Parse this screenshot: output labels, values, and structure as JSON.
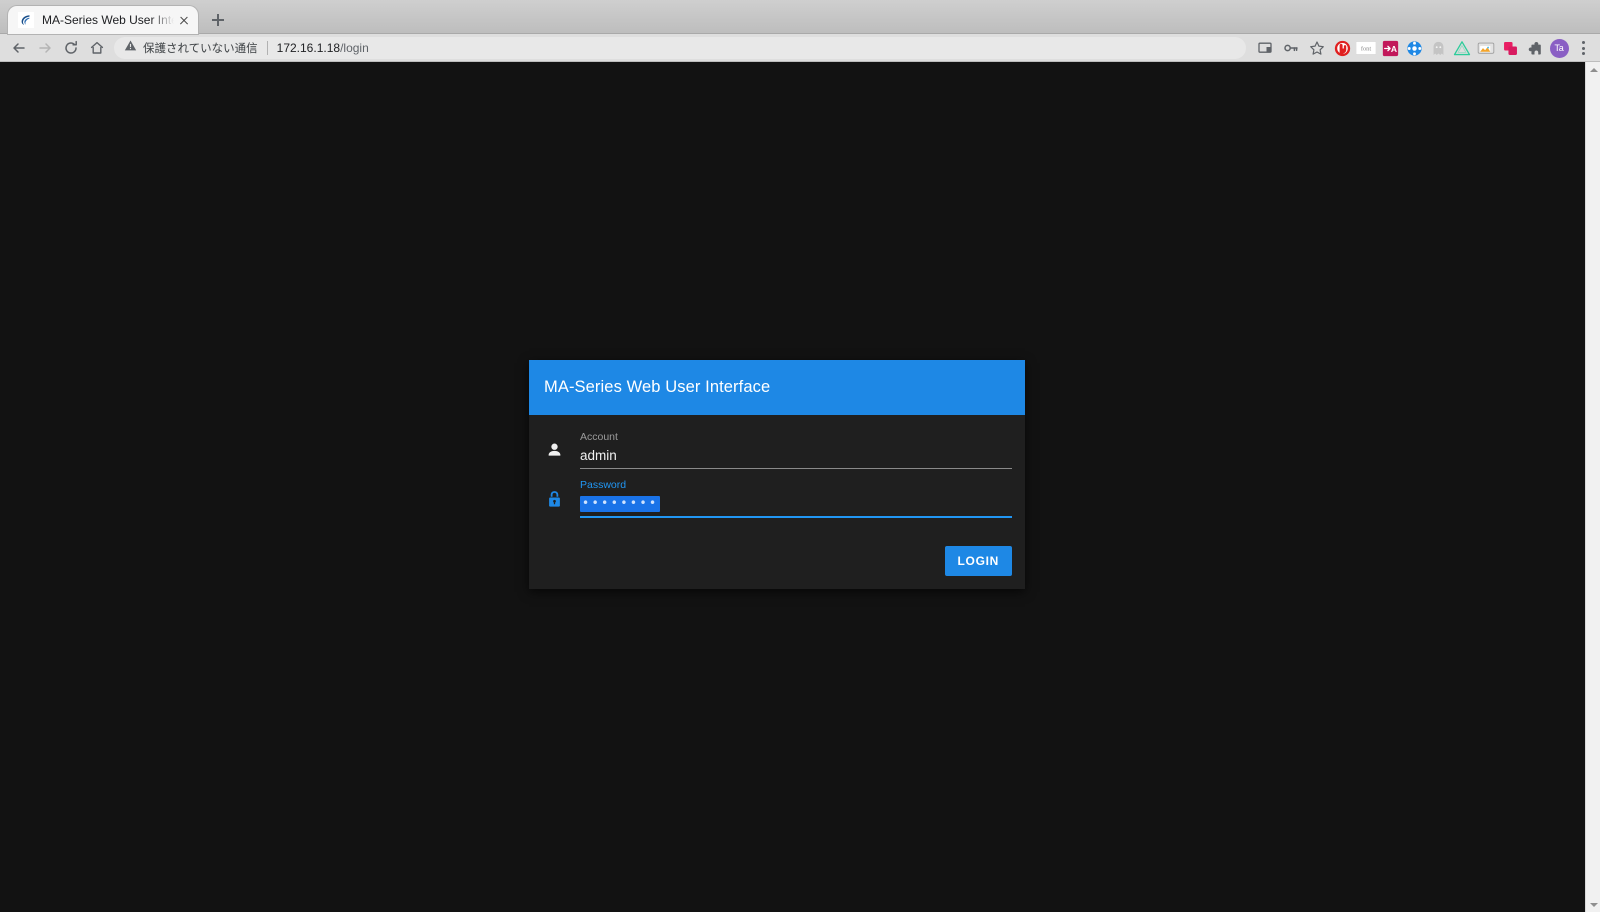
{
  "browser": {
    "tab": {
      "title": "MA-Series Web User Inter",
      "favicon": "crescent-favicon",
      "close_label": "×"
    },
    "new_tab_label": "+",
    "nav": {
      "back": "back-arrow",
      "forward": "forward-arrow",
      "reload": "reload",
      "home": "home"
    },
    "omnibox": {
      "security_text": "保護されていない通信",
      "security_icon": "warning-triangle",
      "url_host": "172.16.1.18",
      "url_path": "/login",
      "separator": "|"
    },
    "toolbar_icons": [
      {
        "name": "cast-icon",
        "glyph": "cast"
      },
      {
        "name": "password-key-icon",
        "glyph": "key"
      },
      {
        "name": "bookmark-star-icon",
        "glyph": "star"
      }
    ],
    "extensions": [
      {
        "name": "ublock-origin-icon",
        "label": "",
        "color": "#e02020"
      },
      {
        "name": "font-extension-icon",
        "label": "font",
        "color": "#ffffff"
      },
      {
        "name": "translate-extension-icon",
        "label": "A",
        "color": "#c2185b"
      },
      {
        "name": "bluetooth-extension-icon",
        "label": "",
        "color": "#1e88e5"
      },
      {
        "name": "ghost-extension-icon",
        "label": "",
        "color": "#bdbdbd"
      },
      {
        "name": "triangle-extension-icon",
        "label": "",
        "color": "#2ecc9b"
      },
      {
        "name": "screenshot-extension-icon",
        "label": "",
        "color": "#9e9e9e"
      },
      {
        "name": "copy-extension-icon",
        "label": "",
        "color": "#e91e63"
      },
      {
        "name": "puzzle-extensions-icon",
        "label": "",
        "color": "#5f6368"
      }
    ],
    "profile": {
      "initials": "Ta",
      "color": "#8a5fc4"
    },
    "menu": "chrome-menu"
  },
  "scrollbar": {
    "up_arrow": "scroll-up",
    "down_arrow": "scroll-down"
  },
  "login": {
    "header_title": "MA-Series Web User Interface",
    "account": {
      "label": "Account",
      "value": "admin",
      "placeholder": "",
      "icon": "person-icon"
    },
    "password": {
      "label": "Password",
      "value": "••••••••",
      "masked_char_count": 8,
      "placeholder": "",
      "icon": "lock-icon",
      "focused": true,
      "selected": true
    },
    "submit_label": "LOGIN",
    "colors": {
      "accent": "#1e88e5",
      "card_bg": "#1f1f1f",
      "page_bg": "#121212",
      "selection": "#1a73e8",
      "label_focused": "#2196f3"
    }
  }
}
